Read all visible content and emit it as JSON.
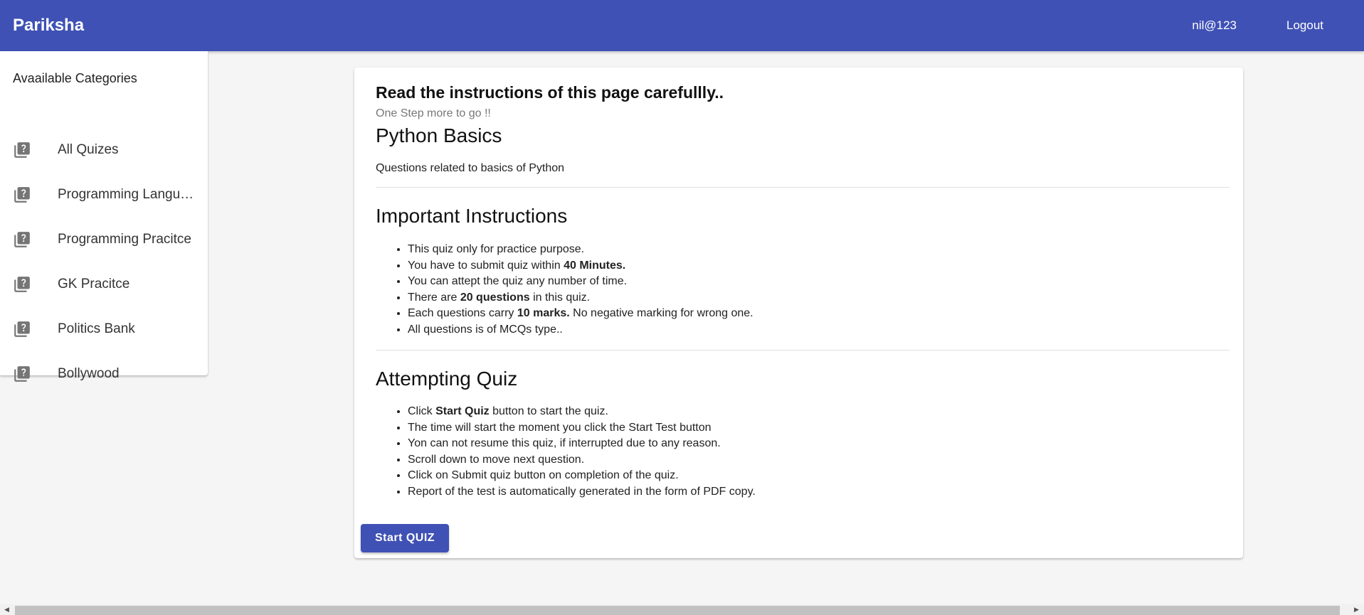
{
  "header": {
    "brand": "Pariksha",
    "username": "nil@123",
    "logout_label": "Logout",
    "bg_color": "#3f51b5"
  },
  "sidebar": {
    "title": "Avaailable Categories",
    "items": [
      {
        "label": "All Quizes",
        "icon": "quiz-icon"
      },
      {
        "label": "Programming Langu…",
        "icon": "quiz-icon"
      },
      {
        "label": "Programming Pracitce",
        "icon": "quiz-icon"
      },
      {
        "label": "GK Pracitce",
        "icon": "quiz-icon"
      },
      {
        "label": "Politics Bank",
        "icon": "quiz-icon"
      },
      {
        "label": "Bollywood",
        "icon": "quiz-icon"
      }
    ]
  },
  "main": {
    "title": "Read the instructions of this page carefullly..",
    "subtitle": "One Step more to go !!",
    "quiz_title": "Python Basics",
    "quiz_description": "Questions related to basics of Python",
    "important": {
      "heading": "Important Instructions",
      "rules": [
        {
          "pre": "This quiz only for practice purpose.",
          "bold": "",
          "post": ""
        },
        {
          "pre": "You have to submit quiz within ",
          "bold": "40 Minutes.",
          "post": ""
        },
        {
          "pre": "You can attept the quiz any number of time.",
          "bold": "",
          "post": ""
        },
        {
          "pre": "There are ",
          "bold": "20 questions",
          "post": " in this quiz."
        },
        {
          "pre": "Each questions carry ",
          "bold": "10 marks.",
          "post": " No negative marking for wrong one."
        },
        {
          "pre": "All questions is of MCQs type..",
          "bold": "",
          "post": ""
        }
      ]
    },
    "attempting": {
      "heading": "Attempting Quiz",
      "rules": [
        {
          "pre": "Click ",
          "bold": "Start Quiz",
          "post": " button to start the quiz."
        },
        {
          "pre": "The time will start the moment you click the Start Test button",
          "bold": "",
          "post": ""
        },
        {
          "pre": "Yon can not resume this quiz, if interrupted due to any reason.",
          "bold": "",
          "post": ""
        },
        {
          "pre": "Scroll down to move next question.",
          "bold": "",
          "post": ""
        },
        {
          "pre": "Click on Submit quiz button on completion of the quiz.",
          "bold": "",
          "post": ""
        },
        {
          "pre": "Report of the test is automatically generated in the form of PDF copy.",
          "bold": "",
          "post": ""
        }
      ]
    },
    "start_button_label": "Start QUIZ"
  }
}
